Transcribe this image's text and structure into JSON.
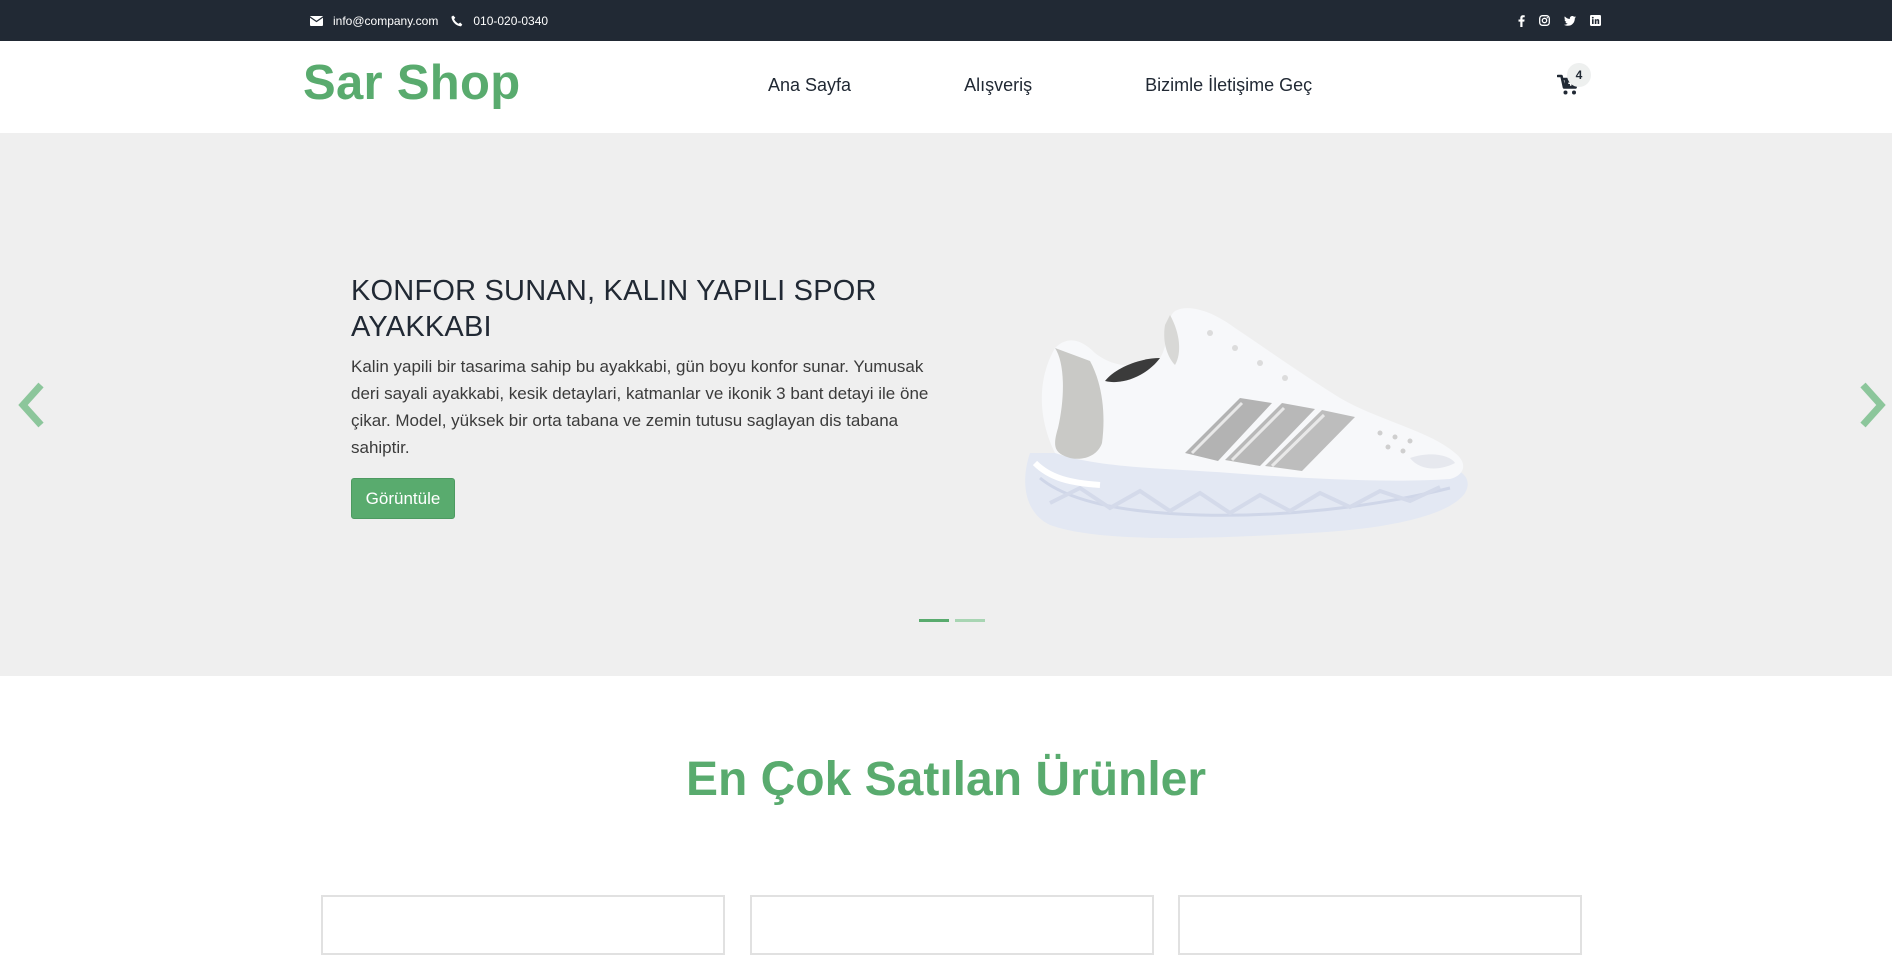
{
  "topbar": {
    "email": "info@company.com",
    "phone": "010-020-0340",
    "social": [
      "facebook-icon",
      "instagram-icon",
      "twitter-icon",
      "linkedin-icon"
    ]
  },
  "header": {
    "logo": "Sar Shop",
    "nav": [
      "Ana Sayfa",
      "Alışveriş",
      "Bizimle İletişime Geç"
    ],
    "cart_count": "4"
  },
  "hero": {
    "title": "KONFOR SUNAN, KALIN YAPILI SPOR AYAKKABI",
    "description": "Kalin yapili bir tasarima sahip bu ayakkabi, gün boyu konfor sunar. Yumusak deri sayali ayakkabi, kesik detaylari, katmanlar ve ikonik 3 bant detayi ile öne çikar. Model, yüksek bir orta tabana ve zemin tutusu saglayan dis tabana sahiptir.",
    "button": "Görüntüle",
    "slides": 2,
    "active_slide": 1
  },
  "featured": {
    "title": "En Çok Satılan Ürünler",
    "cards": 3
  },
  "colors": {
    "accent": "#59ab6e",
    "topbar": "#212934",
    "hero_bg": "#efefef"
  }
}
